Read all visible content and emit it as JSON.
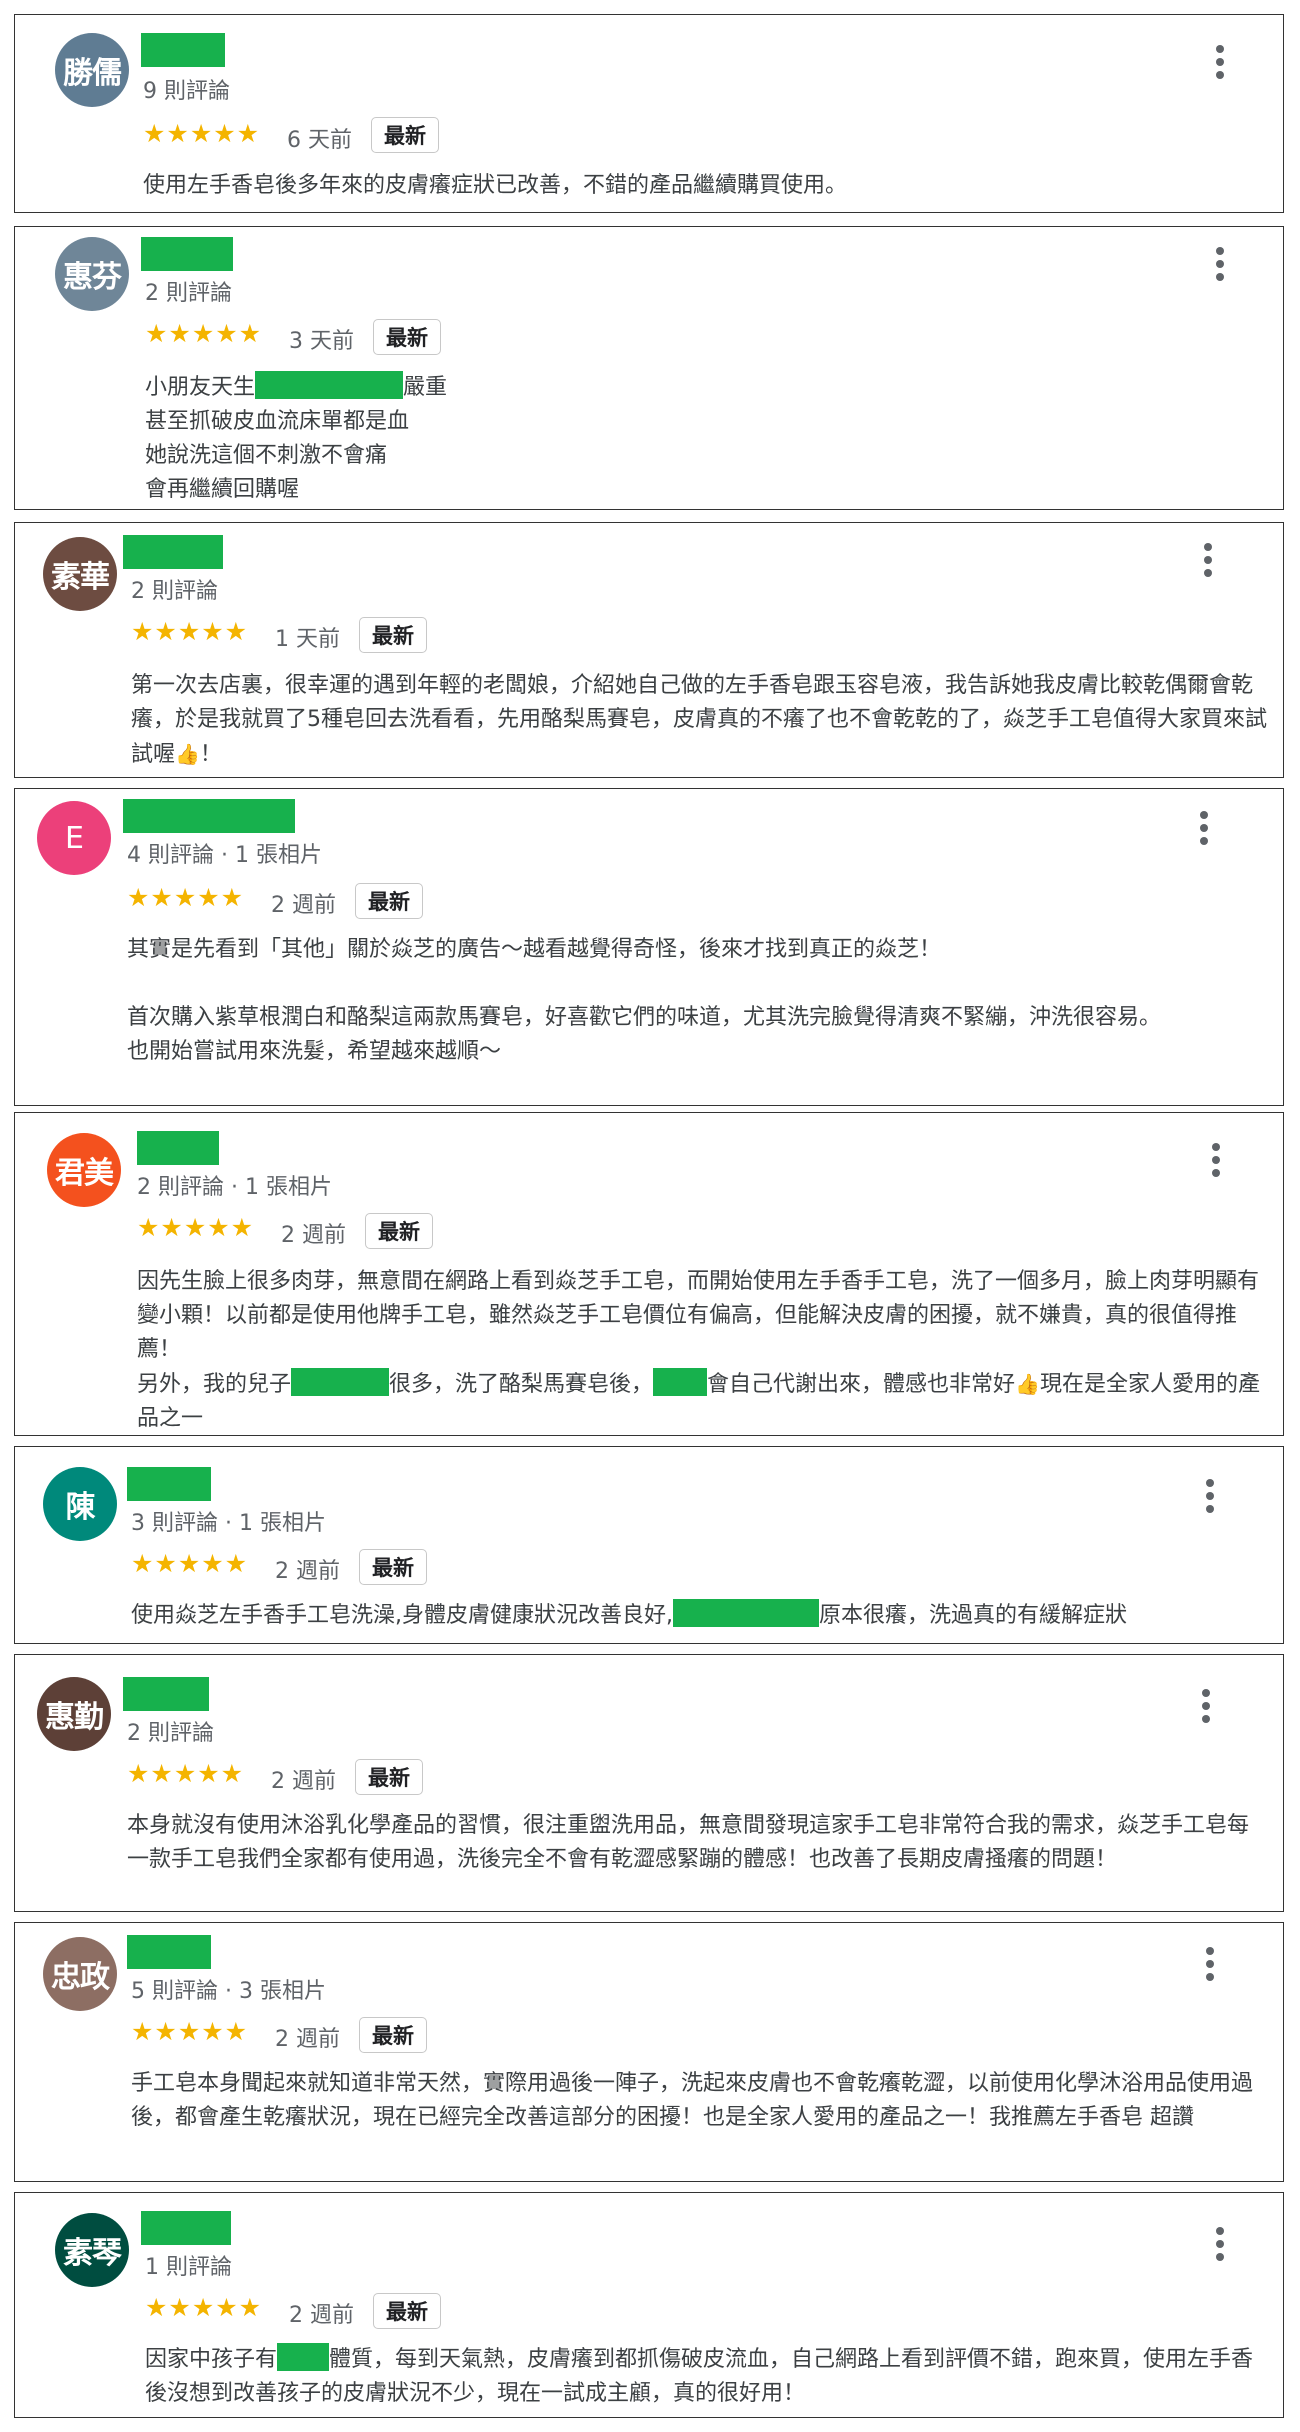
{
  "reviews": [
    {
      "avatar": "勝儒",
      "avatar_color": "#5f7c93",
      "meta": "9 則評論",
      "stars": "★★★★★",
      "rating": 5,
      "date": "6 天前",
      "badge": "最新",
      "text": [
        "使用左手香皂後多年來的皮膚癢症狀已改善，不錯的產品繼續購買使用。"
      ]
    },
    {
      "avatar": "惠芬",
      "avatar_color": "#6f8698",
      "meta": "2 則評論",
      "stars": "★★★★★",
      "rating": 5,
      "date": "3 天前",
      "badge": "最新",
      "text": [
        "小朋友天生",
        "嚴重",
        "甚至抓破皮血流床單都是血",
        "她說洗這個不刺激不會痛",
        "會再繼續回購喔"
      ]
    },
    {
      "avatar": "素華",
      "avatar_color": "#6d4c41",
      "meta": "2 則評論",
      "stars": "★★★★★",
      "rating": 5,
      "date": "1 天前",
      "badge": "最新",
      "text": [
        "第一次去店裏，很幸運的遇到年輕的老闆娘，介紹她自己做的左手香皂跟玉容皂液，我告訴她我皮膚比較乾偶爾會乾癢，於是我就買了5種皂回去洗看看，先用酪梨馬賽皂，皮膚真的不癢了也不會乾乾的了，焱芝手工皂值得大家買來試試喔",
        "！"
      ]
    },
    {
      "avatar": "E",
      "avatar_color": "#ec407a",
      "meta": "4 則評論 · 1 張相片",
      "stars": "★★★★★",
      "rating": 5,
      "date": "2 週前",
      "badge": "最新",
      "text": [
        "其實是先看到「其他」關於焱芝的廣告～越看越覺得奇怪，後來才找到真正的焱芝！",
        "",
        "首次購入紫草根潤白和酪梨這兩款馬賽皂，好喜歡它們的味道，尤其洗完臉覺得清爽不緊繃，沖洗很容易。",
        "也開始嘗試用來洗髮，希望越來越順～"
      ]
    },
    {
      "avatar": "君美",
      "avatar_color": "#f4511e",
      "meta": "2 則評論 · 1 張相片",
      "stars": "★★★★★",
      "rating": 5,
      "date": "2 週前",
      "badge": "最新",
      "text": [
        "因先生臉上很多肉芽，無意間在網路上看到焱芝手工皂，而開始使用左手香手工皂，洗了一個多月，臉上肉芽明顯有變小顆！以前都是使用他牌手工皂，雖然焱芝手工皂價位有偏高，但能解決皮膚的困擾，就不嫌貴，真的很值得推薦！",
        "另外，我的兒子",
        "很多，洗了酪梨馬賽皂後，",
        "會自己代謝出來，體感也非常好",
        "現在是全家人愛用的產品之一"
      ]
    },
    {
      "avatar": "陳",
      "avatar_color": "#00897b",
      "meta": "3 則評論 · 1 張相片",
      "stars": "★★★★★",
      "rating": 5,
      "date": "2 週前",
      "badge": "最新",
      "text": [
        "使用焱芝左手香手工皂洗澡,身體皮膚健康狀況改善良好,",
        "原本很癢，洗過真的有緩解症狀"
      ]
    },
    {
      "avatar": "惠勤",
      "avatar_color": "#5d4037",
      "meta": "2 則評論",
      "stars": "★★★★★",
      "rating": 5,
      "date": "2 週前",
      "badge": "最新",
      "text": [
        "本身就沒有使用沐浴乳化學產品的習慣，很注重盥洗用品，無意間發現這家手工皂非常符合我的需求，焱芝手工皂每一款手工皂我們全家都有使用過，洗後完全不會有乾澀感緊蹦的體感！也改善了長期皮膚搔癢的問題！"
      ]
    },
    {
      "avatar": "忠政",
      "avatar_color": "#8d6e63",
      "meta": "5 則評論 · 3 張相片",
      "stars": "★★★★★",
      "rating": 5,
      "date": "2 週前",
      "badge": "最新",
      "text": [
        "手工皂本身聞起來就知道非常天然，實際用過後一陣子，洗起來皮膚也不會乾癢乾澀，以前使用化學沐浴用品使用過後，都會產生乾癢狀況，現在已經完全改善這部分的困擾！也是全家人愛用的產品之一！我推薦左手香皂  超讚"
      ]
    },
    {
      "avatar": "素琴",
      "avatar_color": "#004d40",
      "meta": "1 則評論",
      "stars": "★★★★★",
      "rating": 5,
      "date": "2 週前",
      "badge": "最新",
      "text": [
        "因家中孩子有",
        "體質，每到天氣熱，皮膚癢到都抓傷破皮流血，自己網路上看到評價不錯，跑來買，使用左手香後沒想到改善孩子的皮膚狀況不少，現在一試成主顧，真的很好用！"
      ]
    }
  ],
  "icons": {
    "menu": "more-vert-icon",
    "thumb": "thumbs-up-icon"
  }
}
